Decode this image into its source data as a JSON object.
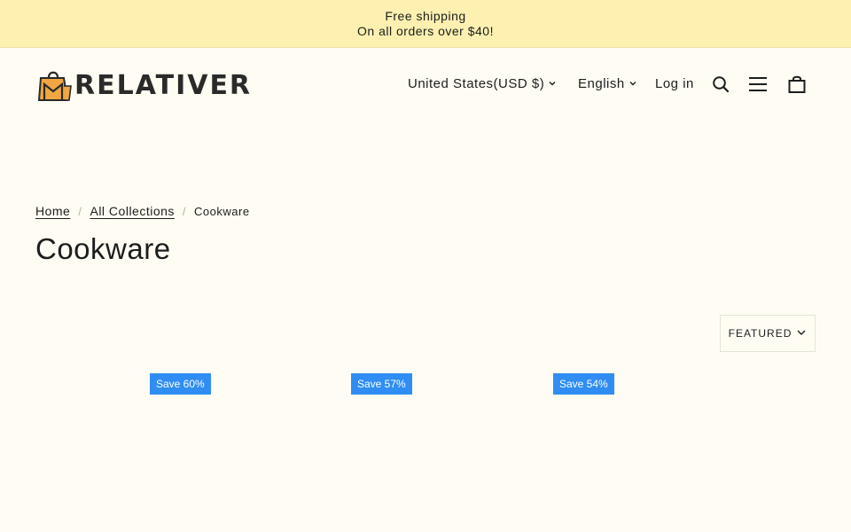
{
  "announcement": {
    "line1": "Free shipping",
    "line2": "On all orders over $40!"
  },
  "header": {
    "logo_text": "RELATIVER",
    "nav": {
      "country": "United States(USD $)",
      "language": "English",
      "login": "Log in"
    },
    "icons": [
      "search-icon",
      "menu-icon",
      "cart-icon"
    ]
  },
  "breadcrumb": {
    "home": "Home",
    "collections": "All Collections",
    "current": "Cookware",
    "separator": "/"
  },
  "page_title": "Cookware",
  "sort": {
    "label": "FEATURED"
  },
  "products": [
    {
      "badge": "Save 60%"
    },
    {
      "badge": "Save 57%"
    },
    {
      "badge": "Save 54%"
    }
  ],
  "colors": {
    "announcement_bg": "#fdf0b0",
    "page_bg": "#fffdf3",
    "badge_bg": "#2f8df3",
    "logo_bag": "#f0a641"
  }
}
